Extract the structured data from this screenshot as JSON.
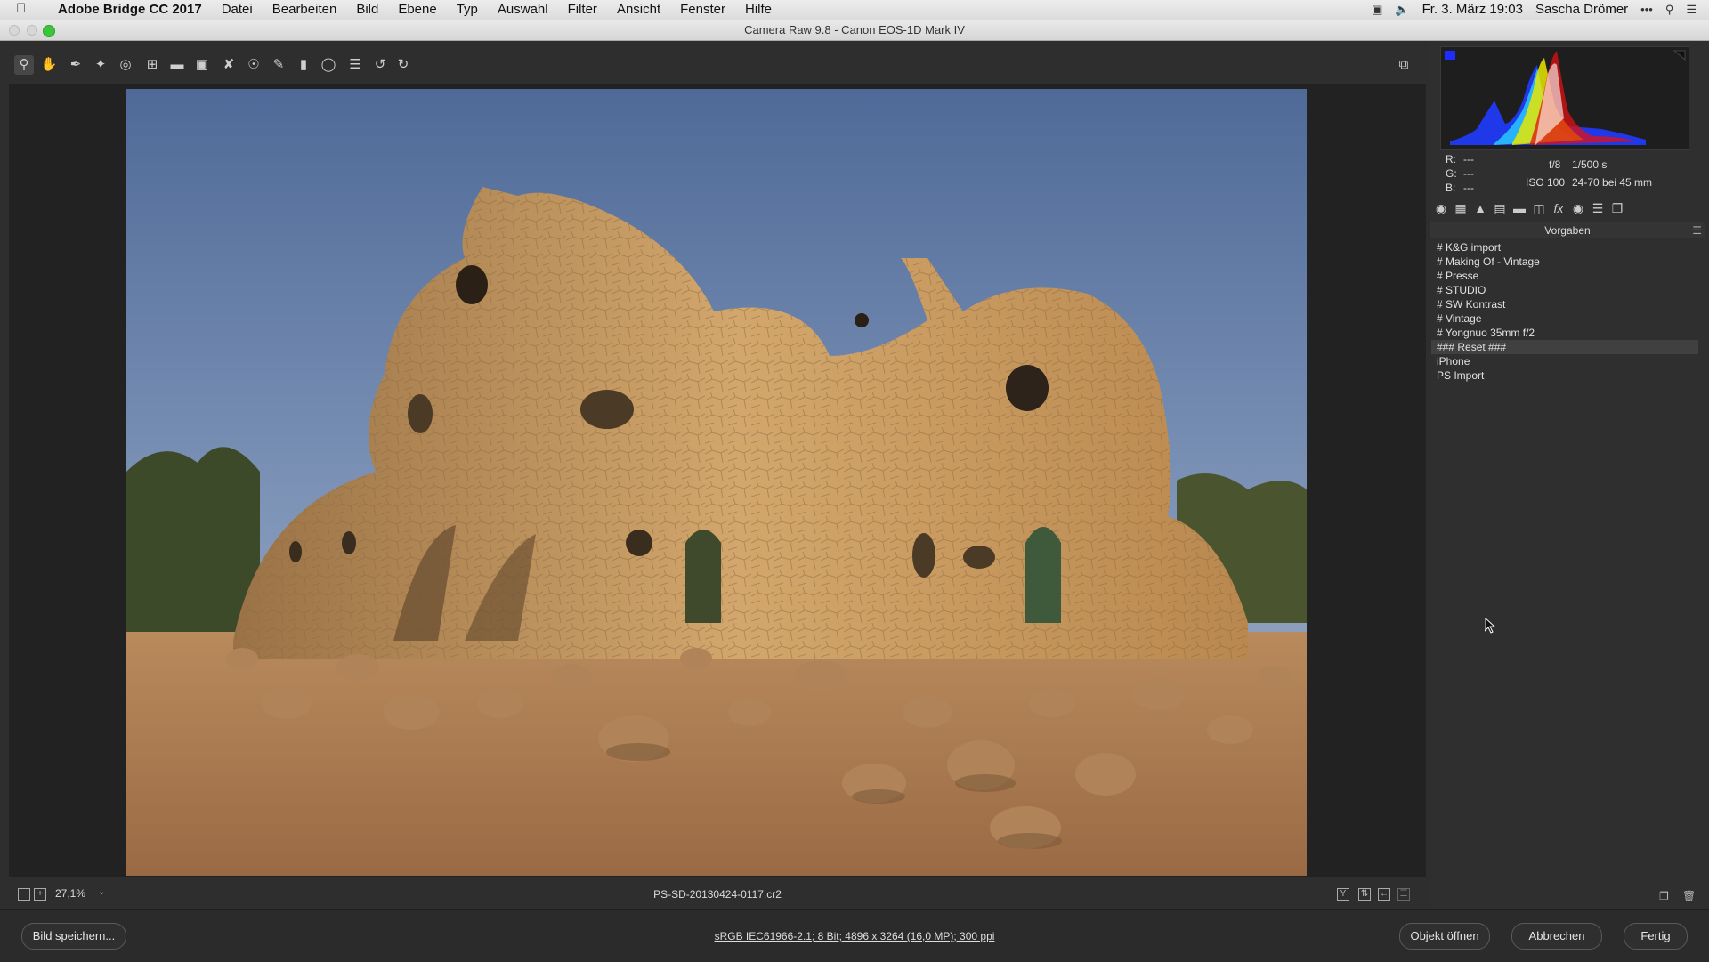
{
  "menubar": {
    "app_name": "Adobe Bridge CC 2017",
    "items": [
      "Datei",
      "Bearbeiten",
      "Bild",
      "Ebene",
      "Typ",
      "Auswahl",
      "Filter",
      "Ansicht",
      "Fenster",
      "Hilfe"
    ],
    "clock": "Fr. 3. März 19:03",
    "user": "Sascha Drömer"
  },
  "window": {
    "title": "Camera Raw 9.8 - Canon EOS-1D Mark IV"
  },
  "preview": {
    "zoom": "27,1%",
    "filename": "PS-SD-20130424-0117.cr2"
  },
  "readout": {
    "r_label": "R:",
    "r_value": "---",
    "g_label": "G:",
    "g_value": "---",
    "b_label": "B:",
    "b_value": "---",
    "aperture": "f/8",
    "shutter": "1/500 s",
    "iso": "ISO 100",
    "lens": "24-70 bei 45 mm"
  },
  "panel": {
    "section_title": "Vorgaben",
    "presets": [
      "# K&G import",
      "# Making Of - Vintage",
      "# Presse",
      "# STUDIO",
      "# SW Kontrast",
      "# Vintage",
      "# Yongnuo 35mm f/2",
      "### Reset ###",
      "iPhone",
      "PS Import"
    ],
    "selected_index": 7
  },
  "actionbar": {
    "save_label": "Bild speichern...",
    "file_info": "sRGB IEC61966-2.1; 8 Bit; 4896 x 3264 (16,0 MP); 300 ppi",
    "open_label": "Objekt öffnen",
    "cancel_label": "Abbrechen",
    "done_label": "Fertig"
  },
  "colors": {
    "panel_bg": "#2f2f2f",
    "sky": "#5f7aa6",
    "stone": "#c9995e",
    "sand": "#a8734a"
  }
}
